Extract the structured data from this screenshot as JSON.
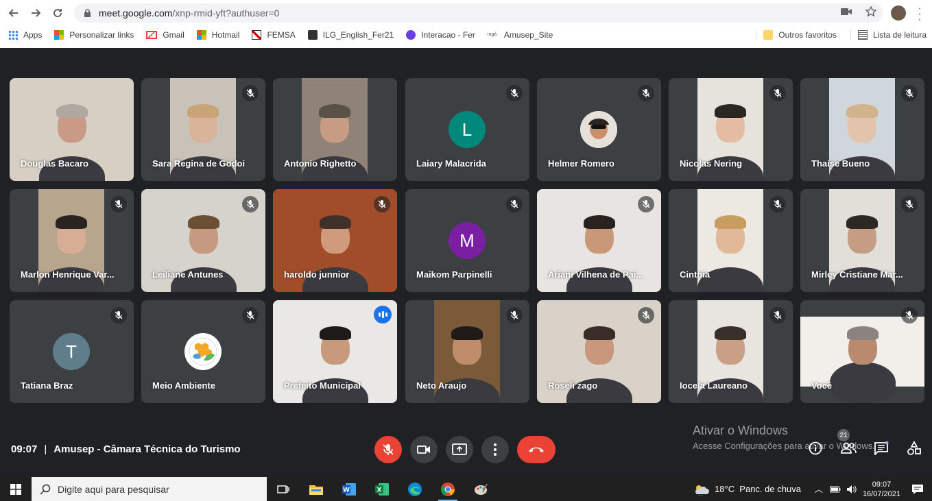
{
  "browser": {
    "url_host": "meet.google.com",
    "url_path": "/xnp-rmid-yft?authuser=0",
    "bookmarks": [
      {
        "label": "Apps",
        "icon": "apps-grid-icon"
      },
      {
        "label": "Personalizar links",
        "icon": "windows-logo-icon"
      },
      {
        "label": "Gmail",
        "icon": "gmail-icon"
      },
      {
        "label": "Hotmail",
        "icon": "windows-logo-icon"
      },
      {
        "label": "FEMSA",
        "icon": "femsa-icon"
      },
      {
        "label": "ILG_English_Fer21",
        "icon": "id-card-icon"
      },
      {
        "label": "Interacao - Fer",
        "icon": "purple-circle-icon"
      },
      {
        "label": "Amusep_Site",
        "icon": "inga-icon"
      }
    ],
    "other_favorites": "Outros favoritos",
    "reading_list": "Lista de leitura"
  },
  "participants": [
    {
      "name": "Douglas Bacaro",
      "kind": "video",
      "muted": false
    },
    {
      "name": "Sara Regina de Godoi",
      "kind": "video",
      "muted": true
    },
    {
      "name": "Antonio Righetto",
      "kind": "video",
      "muted": false
    },
    {
      "name": "Laiary Malacrida",
      "kind": "avatar",
      "initial": "L",
      "color": "#00897b",
      "muted": true
    },
    {
      "name": "Helmer Romero",
      "kind": "photo",
      "muted": true
    },
    {
      "name": "Nicolas Nering",
      "kind": "video",
      "muted": true
    },
    {
      "name": "Thaíse Bueno",
      "kind": "video",
      "muted": true
    },
    {
      "name": "Marlon Henrique Var...",
      "kind": "video",
      "muted": true
    },
    {
      "name": "Leiliane Antunes",
      "kind": "video",
      "muted": true
    },
    {
      "name": "haroldo junnior",
      "kind": "video",
      "muted": true
    },
    {
      "name": "Maikom Parpinelli",
      "kind": "avatar",
      "initial": "M",
      "color": "#7b1fa2",
      "muted": true
    },
    {
      "name": "Ariani Vilhena de Pai...",
      "kind": "video",
      "muted": true
    },
    {
      "name": "Cinthia",
      "kind": "video",
      "muted": true
    },
    {
      "name": "Mirley Cristiane Mar...",
      "kind": "video",
      "muted": true
    },
    {
      "name": "Tatiana Braz",
      "kind": "avatar",
      "initial": "T",
      "color": "#607d8b",
      "muted": true
    },
    {
      "name": "Meio Ambiente",
      "kind": "logo",
      "muted": true
    },
    {
      "name": "Prefeito Municipal",
      "kind": "video",
      "muted": false,
      "speaking": true
    },
    {
      "name": "Neto Araujo",
      "kind": "video",
      "muted": true
    },
    {
      "name": "Roseli zago",
      "kind": "video",
      "muted": true
    },
    {
      "name": "Iocela Laureano",
      "kind": "video",
      "muted": true
    },
    {
      "name": "Você",
      "kind": "video",
      "muted": true
    }
  ],
  "meeting": {
    "time": "09:07",
    "title": "Amusep - Câmara Técnica do Turismo",
    "participant_count": "21"
  },
  "windows_watermark": {
    "line1": "Ativar o Windows",
    "line2": "Acesse Configurações para ativar o Windows."
  },
  "taskbar": {
    "search_placeholder": "Digite aqui para pesquisar",
    "weather": "18°C  Panc. de chuva",
    "time": "09:07",
    "date": "16/07/2021"
  }
}
